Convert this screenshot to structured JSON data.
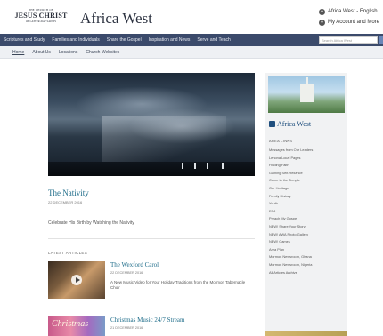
{
  "header": {
    "logo_line1": "THE CHURCH OF",
    "logo_line2": "JESUS CHRIST",
    "logo_line3": "OF LATTER-DAY SAINTS",
    "site_title": "Africa West",
    "util_language": "Africa West - English",
    "util_account": "My Account and More"
  },
  "nav": {
    "items": [
      "Scriptures and Study",
      "Families and Individuals",
      "Share the Gospel",
      "Inspiration and News",
      "Serve and Teach"
    ],
    "search_placeholder": "Search Africa West"
  },
  "subnav": {
    "items": [
      "Home",
      "About Us",
      "Locations",
      "Church Websites"
    ]
  },
  "feature": {
    "title": "The Nativity",
    "date": "22 DECEMBER 2016",
    "description": "Celebrate His Birth by Watching the Nativity"
  },
  "latest": {
    "label": "LATEST ARTICLES",
    "articles": [
      {
        "title": "The Wexford Carol",
        "date": "22 DECEMBER 2016",
        "description": "A New Music Video for Your Holiday Traditions from the Mormon Tabernacle Choir"
      },
      {
        "title": "Christmas Music 24/7 Stream",
        "date": "21 DECEMBER 2016",
        "thumb_word": "Christmas"
      }
    ]
  },
  "sidebar": {
    "brand": "Africa West",
    "links_label": "AREA LINKS",
    "links": [
      "Messages from Our Leaders",
      "Lehona Local Pages",
      "Finding Faith",
      "Gaining Self-Reliance",
      "Come to the Temple",
      "Our Heritage",
      "Family History",
      "Youth",
      "FSA",
      "Preach My Gospel",
      "NEW! Share Your Story",
      "NEW! AWA Photo Gallery",
      "NEW! Games",
      "Area Plan",
      "Mormon Newsroom, Ghana",
      "Mormon Newsroom, Nigeria",
      "All Articles Archive"
    ]
  }
}
